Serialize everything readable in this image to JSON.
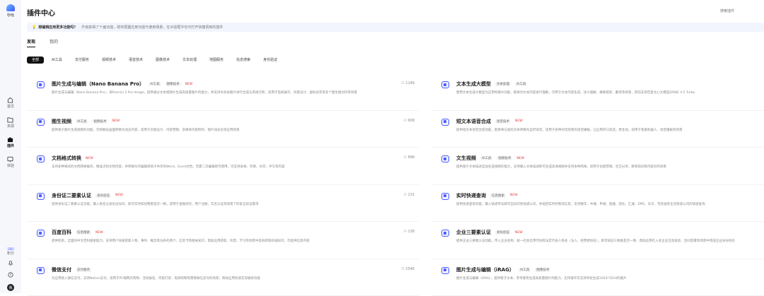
{
  "app": {
    "logo_text": "秒哒",
    "title": "插件中心",
    "search_placeholder": "搜索插件"
  },
  "sidebar": {
    "items": [
      {
        "label": "首页"
      },
      {
        "label": "资源"
      },
      {
        "label": "插件"
      },
      {
        "label": "体验"
      }
    ],
    "points_value": "100",
    "points_label": "积分",
    "avatar": "我"
  },
  "notice": {
    "title": "想编辑应用更多功能吗？",
    "text": "升级获得了十面功能，助你把握应用功能与使用场景，在对话框中也可打开快捷调用的插件"
  },
  "tabs": [
    {
      "label": "发现"
    },
    {
      "label": "我的"
    }
  ],
  "chips": [
    "全部",
    "AI工具",
    "支付服务",
    "视频技术",
    "语音技术",
    "图像技术",
    "文本处理",
    "地图服务",
    "信息搜索",
    "身份验证"
  ],
  "new_label": "NEW",
  "plugins": [
    {
      "name": "图片生成与编辑（Nano Banana Pro）",
      "tags": [
        "AI工具",
        "图像技术"
      ],
      "new": true,
      "users": "1149",
      "desc": "图片生成与编辑（Nano Banana Pro），即Gemini 3 Pro Image，提供通过文本或图片生成高质量图片的能力，并支持对多张图片进行合成与风格迁移，适用于电商展示、创意设计、虚拟试衣等多个图生图创作等场景"
    },
    {
      "name": "文本生成大模型",
      "tags": [
        "文本处理",
        "AI工具"
      ],
      "new": false,
      "users": "",
      "desc": "使用文本生成大模型为应用构建AI功能，能够对文本内容进行理解，可用于文本内容生成、语义理解、摘要提炼、翻译等场景，目前支持百度文心大模型ERNIE 4.5 Turbo"
    },
    {
      "name": "图生视频",
      "tags": [
        "AI工具",
        "视频技术"
      ],
      "new": true,
      "users": "908",
      "desc": "提供基于图片生成视频的功能，可将静态画面转换为动态内容，适用于创意设计、内容营销、多媒体内容制作、图片动态化等应用场景"
    },
    {
      "name": "短文本语音合成",
      "tags": [
        "语音技术"
      ],
      "new": true,
      "users": "",
      "desc": "提供短文本语音合成功能，能够将与短的文本转换为自然语音，适用于各种对话场景的语音播报，让应用开口说话，更生动，适用于客服机器人、语音播报等场景"
    },
    {
      "name": "文档格式转换",
      "tags": [],
      "new": true,
      "users": "996",
      "desc": "支持多种格式的文档转换服务，精准识别文档内容，并转换为可编辑或易于共享的Word、Excel文档，无需二次编辑即可使用，可支持表格、印章、水印、手写等内容"
    },
    {
      "name": "文生视频",
      "tags": [
        "AI工具",
        "视频技术"
      ],
      "new": true,
      "users": "",
      "desc": "提供基于文本描述自动生成视频的能力，支持输入文本描述即可生成高清视频并支持多种风格，适用于创意营销、社交分享、教育培训等内容创作场景"
    },
    {
      "name": "身份证二要素认证",
      "tags": [
        "身份验证"
      ],
      "new": true,
      "users": "131",
      "desc": "提供身份证二要素认证功能，输入姓名与身份证号码，即可实时校验两者是否一致，适用于金融风控、用户注册、实名认证等场景下的安全验证需求"
    },
    {
      "name": "实时快递查询",
      "tags": [
        "信息搜索"
      ],
      "new": true,
      "users": "",
      "desc": "提供快递查询功能，输入快递单号即可自动识别快递公司，并返回实时的物流信息，支持顺丰、中通、申通、圆通、韵达、汇通、EMS、天天、宅急送等主流快递公司的快递查询"
    },
    {
      "name": "百度百科",
      "tags": [
        "信息搜索"
      ],
      "new": true,
      "users": "138",
      "desc": "提供检索、全面的中文百科搜索能力，支持用户快速获取人物、事件、概念等词条的简介、信息卡和相关知识，帮助应用获取、科普、学习等场景中高效获取权威知识，可提供信息内容"
    },
    {
      "name": "企业三要素认证",
      "tags": [
        "身份验证"
      ],
      "new": true,
      "users": "",
      "desc": "提供企业三要素认证功能，传入企业名称、统一社会信用代码和法定代表人姓名（法人、经营者姓名），即可核验三要素是否一致，帮助应用在入驻企业信息核验、合同签署等场景中完成企业身份校验"
    },
    {
      "name": "微信支付",
      "tags": [
        "支付服务"
      ],
      "new": false,
      "users": "2546",
      "desc": "为应用接入微信支付，支持Native支付，适用于PC端网页购物、活动报名、内容打赏、电商购物等需要微信支付的场景，帮助应用快速实现收款功能"
    },
    {
      "name": "图片生成与编辑（iRAG）",
      "tags": [
        "AI工具",
        "图像技术"
      ],
      "new": false,
      "users": "",
      "desc": "图片生成与编辑（iRAG），提供基于文本、参考图等生成高质量图片的能力，支持操作仅支持单张生成1024*1024的图片"
    }
  ]
}
